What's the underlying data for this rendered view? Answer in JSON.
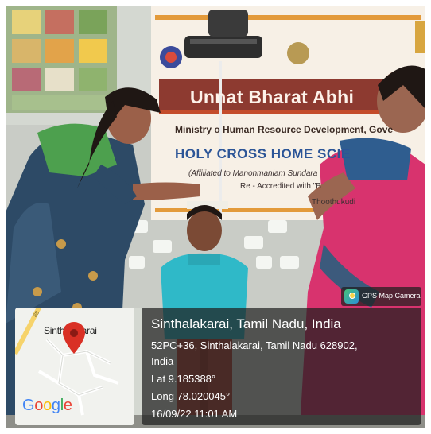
{
  "photo": {
    "banner": {
      "title": "Unnat Bharat Abhi",
      "ministry": "Ministry o  Human Resource Development, Gove",
      "college": "HOLY CROSS HOME SCIE",
      "affiliation": "(Affiliated to Manonmaniam Sundara",
      "accredited": "Re - Accredited with \"B",
      "city": "Thoothukudi"
    }
  },
  "gps_overlay": {
    "badge_label": "GPS Map Camera",
    "place_title": "Sinthalakarai, Tamil Nadu, India",
    "address_line_1": "52PC+36, Sinthalakarai, Tamil Nadu 628902,",
    "address_line_2": "India",
    "latitude": "Lat 9.185388°",
    "longitude": "Long 78.020045°",
    "timestamp": "16/09/22 11:01 AM",
    "map": {
      "place_label": "Sinthalakarai",
      "road_number": "38",
      "logo_letters": [
        "G",
        "o",
        "o",
        "g",
        "l",
        "e"
      ],
      "pin_color": "#d93025"
    }
  },
  "colors": {
    "banner_maroon": "#8d3a30",
    "banner_blue_text": "#2c5597",
    "overlay_bg": "#1e1e1e"
  }
}
